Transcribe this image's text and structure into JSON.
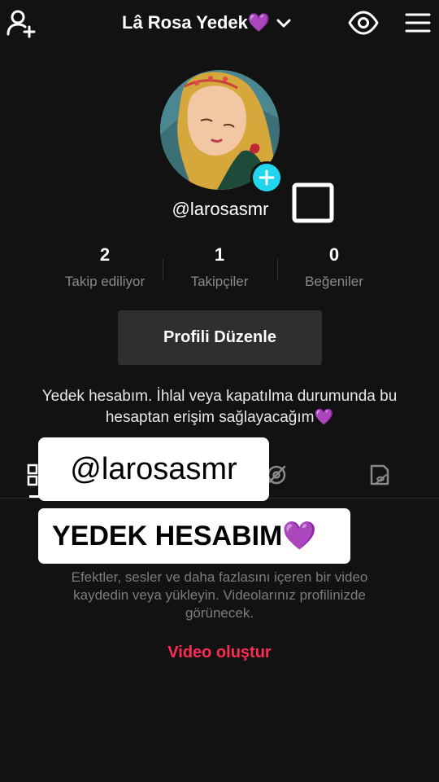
{
  "header": {
    "title": "Lâ Rosa Yedek💜",
    "icons": {
      "left": "add-user-icon",
      "dropdown": "chevron-down-icon",
      "view": "eye-icon",
      "menu": "hamburger-menu-icon"
    }
  },
  "profile": {
    "username": "@larosasmr",
    "avatar_icon": "avatar-image",
    "add_badge": "plus-icon",
    "qr_icon": "square-icon"
  },
  "stats": [
    {
      "value": "2",
      "label": "Takip ediliyor"
    },
    {
      "value": "1",
      "label": "Takipçiler"
    },
    {
      "value": "0",
      "label": "Beğeniler"
    }
  ],
  "edit_profile_label": "Profili Düzenle",
  "bio": "Yedek hesabım. İhlal veya kapatılma durumunda bu hesaptan erişim sağlayacağım💜",
  "tabs": [
    "videos-grid-icon",
    "private-lock-icon",
    "liked-hidden-icon"
  ],
  "overlays": {
    "handle": "@larosasmr",
    "caption": "YEDEK HESABIM💜"
  },
  "empty_state": {
    "text": "Efektler, sesler ve daha fazlasını içeren bir video kaydedin veya yükleyin. Videolarınız profilinizde görünecek.",
    "create_label": "Video oluştur"
  },
  "colors": {
    "background": "#121212",
    "accent": "#fe2c55",
    "badge": "#20d5ec",
    "button": "#2f2f2f"
  }
}
